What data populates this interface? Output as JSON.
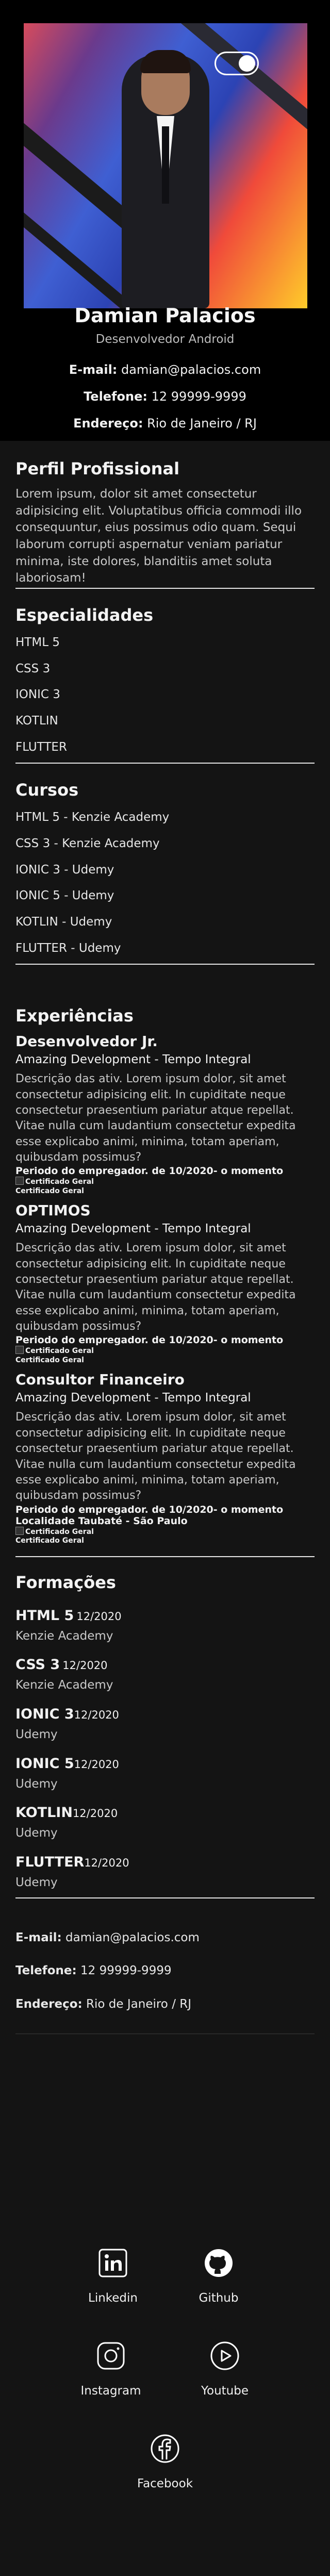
{
  "profile": {
    "name": "Damian Palacios",
    "role": "Desenvolvedor Android",
    "email_label": "E-mail:",
    "email": "damian@palacios.com",
    "phone_label": "Telefone:",
    "phone": "12 99999-9999",
    "address_label": "Endereço:",
    "address": "Rio de Janeiro / RJ"
  },
  "perfil": {
    "title": "Perfil Profissional",
    "text": "Lorem ipsum, dolor sit amet consectetur adipisicing elit. Voluptatibus officia commodi illo consequuntur, eius possimus odio quam. Sequi laborum corrupti aspernatur veniam pariatur minima, iste dolores, blanditiis amet soluta laboriosam!"
  },
  "especialidades": {
    "title": "Especialidades",
    "items": [
      "HTML 5",
      "CSS 3",
      "IONIC 3",
      "KOTLIN",
      "FLUTTER"
    ]
  },
  "cursos": {
    "title": "Cursos",
    "items": [
      "HTML 5 - Kenzie Academy",
      "CSS 3 - Kenzie Academy",
      "IONIC 3 - Udemy",
      "IONIC 5 - Udemy",
      "KOTLIN - Udemy",
      "FLUTTER - Udemy"
    ]
  },
  "experiencias": {
    "title": "Experiências",
    "jobs": [
      {
        "title": "Desenvolvedor Jr.",
        "company": "Amazing Development - Tempo Integral",
        "desc": "Descrição das ativ. Lorem ipsum dolor, sit amet consectetur adipisicing elit. In cupiditate neque consectetur praesentium pariatur atque repellat. Vitae nulla cum laudantium consectetur expedita esse explicabo animi, minima, totam aperiam, quibusdam possimus?",
        "period": "Periodo do empregador. de 10/2020- o momento",
        "location": "",
        "cert_alt": "Certificado Geral",
        "cert_caption": "Certificado Geral"
      },
      {
        "title": "OPTIMOS",
        "company": "Amazing Development - Tempo Integral",
        "desc": "Descrição das ativ. Lorem ipsum dolor, sit amet consectetur adipisicing elit. In cupiditate neque consectetur praesentium pariatur atque repellat. Vitae nulla cum laudantium consectetur expedita esse explicabo animi, minima, totam aperiam, quibusdam possimus?",
        "period": "Periodo do empregador. de 10/2020- o momento",
        "location": "",
        "cert_alt": "Certificado Geral",
        "cert_caption": "Certificado Geral"
      },
      {
        "title": "Consultor Financeiro",
        "company": "Amazing Development - Tempo Integral",
        "desc": "Descrição das ativ. Lorem ipsum dolor, sit amet consectetur adipisicing elit. In cupiditate neque consectetur praesentium pariatur atque repellat. Vitae nulla cum laudantium consectetur expedita esse explicabo animi, minima, totam aperiam, quibusdam possimus?",
        "period": "Periodo do empregador. de 10/2020- o momento",
        "location": "Localidade Taubaté - São Paulo",
        "cert_alt": "Certificado Geral",
        "cert_caption": "Certificado Geral"
      }
    ]
  },
  "formacoes": {
    "title": "Formações",
    "items": [
      {
        "name": "HTML 5",
        "date": "12/2020",
        "school": "Kenzie Academy"
      },
      {
        "name": "CSS 3",
        "date": "12/2020",
        "school": "Kenzie Academy"
      },
      {
        "name": "IONIC 3",
        "date": "12/2020",
        "school": "Udemy"
      },
      {
        "name": "IONIC 5",
        "date": "12/2020",
        "school": "Udemy"
      },
      {
        "name": "KOTLIN",
        "date": "12/2020",
        "school": "Udemy"
      },
      {
        "name": "FLUTTER",
        "date": "12/2020",
        "school": "Udemy"
      }
    ]
  },
  "contato": {
    "email_label": "E-mail:",
    "email": "damian@palacios.com",
    "phone_label": "Telefone:",
    "phone": "12 99999-9999",
    "address_label": "Endereço:",
    "address": "Rio de Janeiro / RJ"
  },
  "social": {
    "linkedin": "Linkedin",
    "github": "Github",
    "instagram": "Instagram",
    "youtube": "Youtube",
    "facebook": "Facebook"
  },
  "colors": {
    "background": "#141414",
    "header_bg": "#000000",
    "divider": "#e6e6e6"
  }
}
